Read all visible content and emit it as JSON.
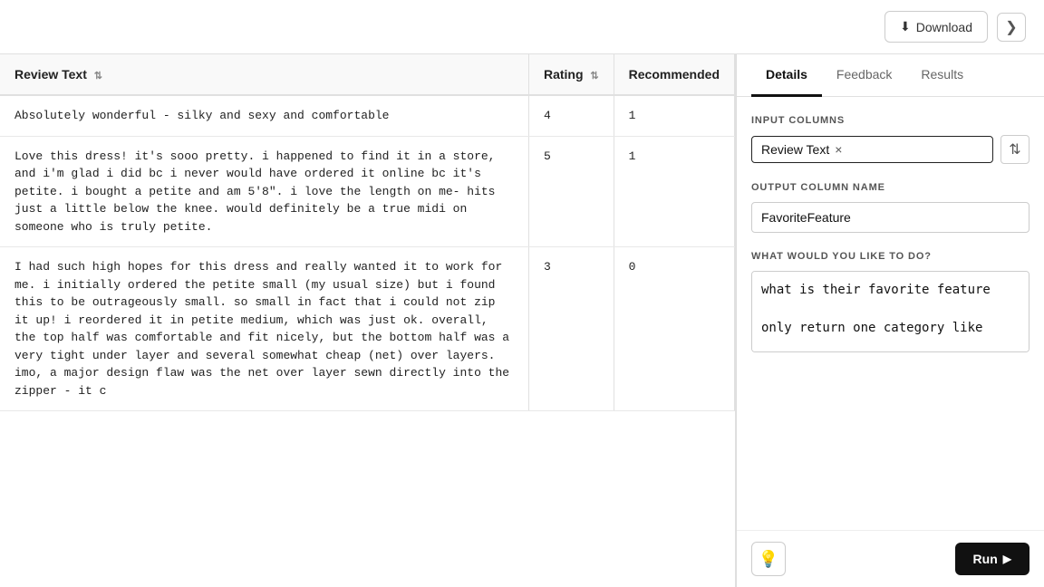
{
  "topbar": {
    "download_label": "Download",
    "expand_icon": "❯"
  },
  "table": {
    "columns": [
      {
        "key": "review_text",
        "label": "Review Text",
        "sortable": true
      },
      {
        "key": "rating",
        "label": "Rating",
        "sortable": true
      },
      {
        "key": "recommended",
        "label": "Recommended",
        "sortable": false
      }
    ],
    "rows": [
      {
        "review_text": "Absolutely wonderful - silky and sexy and comfortable",
        "rating": "4",
        "recommended": "1"
      },
      {
        "review_text": "Love this dress! it's sooo pretty. i happened to find it in a store, and i'm glad i did bc i never would have ordered it online bc it's petite. i bought a petite and am 5'8\". i love the length on me- hits just a little below the knee. would definitely be a true midi on someone who is truly petite.",
        "rating": "5",
        "recommended": "1"
      },
      {
        "review_text": "I had such high hopes for this dress and really wanted it to work for me. i initially ordered the petite small (my usual size) but i found this to be outrageously small. so small in fact that i could not zip it up! i reordered it in petite medium, which was just ok. overall, the top half was comfortable and fit nicely, but the bottom half was a very tight under layer and several somewhat cheap (net) over layers. imo, a major design flaw was the net over layer sewn directly into the zipper - it c",
        "rating": "3",
        "recommended": "0"
      }
    ]
  },
  "right_panel": {
    "tabs": [
      {
        "key": "details",
        "label": "Details",
        "active": true
      },
      {
        "key": "feedback",
        "label": "Feedback",
        "active": false
      },
      {
        "key": "results",
        "label": "Results",
        "active": false
      }
    ],
    "input_columns_label": "INPUT COLUMNS",
    "input_column_tag": "Review Text",
    "tag_close_symbol": "×",
    "sort_icon": "⇅",
    "output_column_label": "OUTPUT COLUMN NAME",
    "output_column_value": "FavoriteFeature",
    "what_label": "WHAT WOULD YOU LIKE TO DO?",
    "what_text": "what is their favorite feature\n\nonly return one category like\n\nfit, sty",
    "lightbulb_icon": "💡",
    "run_label": "Run",
    "run_icon": "▶"
  }
}
